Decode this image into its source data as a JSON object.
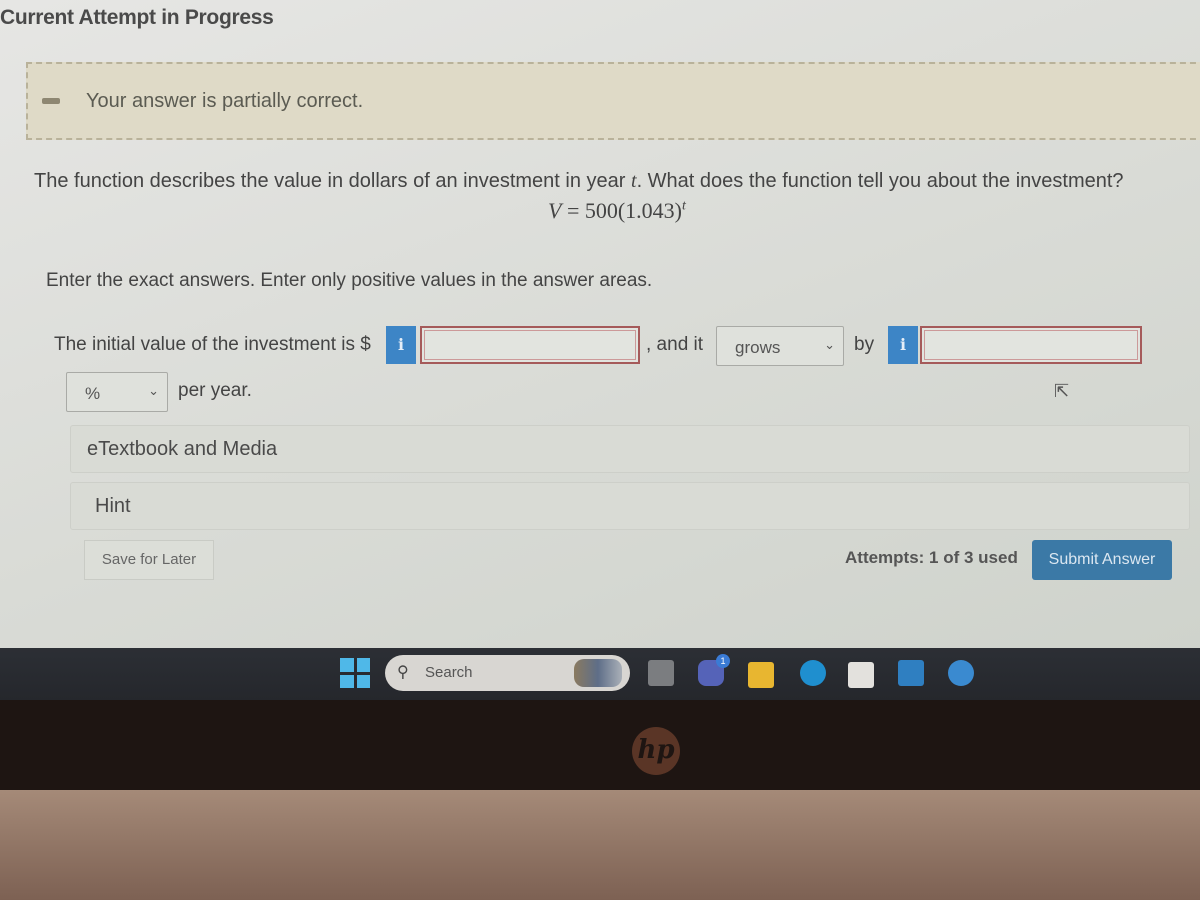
{
  "header": {
    "title": "Current Attempt in Progress"
  },
  "feedback": {
    "message": "Your answer is partially correct.",
    "status": "partial"
  },
  "question": {
    "text_before_t": "The function describes the value in dollars of an investment in year ",
    "variable": "t",
    "text_after_t": ".  What does the function tell you about the investment?",
    "formula_lhs": "V",
    "formula_eq": " = 500(1.043)",
    "formula_exp": "t",
    "instructions": "Enter the exact answers. Enter only positive values in the answer areas."
  },
  "answer_row": {
    "prefix": "The initial value of the investment is $",
    "info_label": "i",
    "initial_value_input": "",
    "middle": ", and it",
    "trend_select": {
      "selected": "grows"
    },
    "by_label": "by",
    "rate_input": "",
    "unit_select": {
      "selected": "%"
    },
    "suffix": "per year."
  },
  "panels": [
    {
      "label": "eTextbook and Media"
    },
    {
      "label": "Hint"
    }
  ],
  "footer": {
    "save_label": "Save for Later",
    "attempts": "Attempts: 1 of 3 used",
    "submit_label": "Submit Answer"
  },
  "taskbar": {
    "search_placeholder": "Search",
    "chat_badge": "1"
  },
  "device": {
    "brand": "hp"
  },
  "colors": {
    "accent": "#3d85c6",
    "submit": "#3b79a6",
    "error_border": "#a55a5a"
  }
}
